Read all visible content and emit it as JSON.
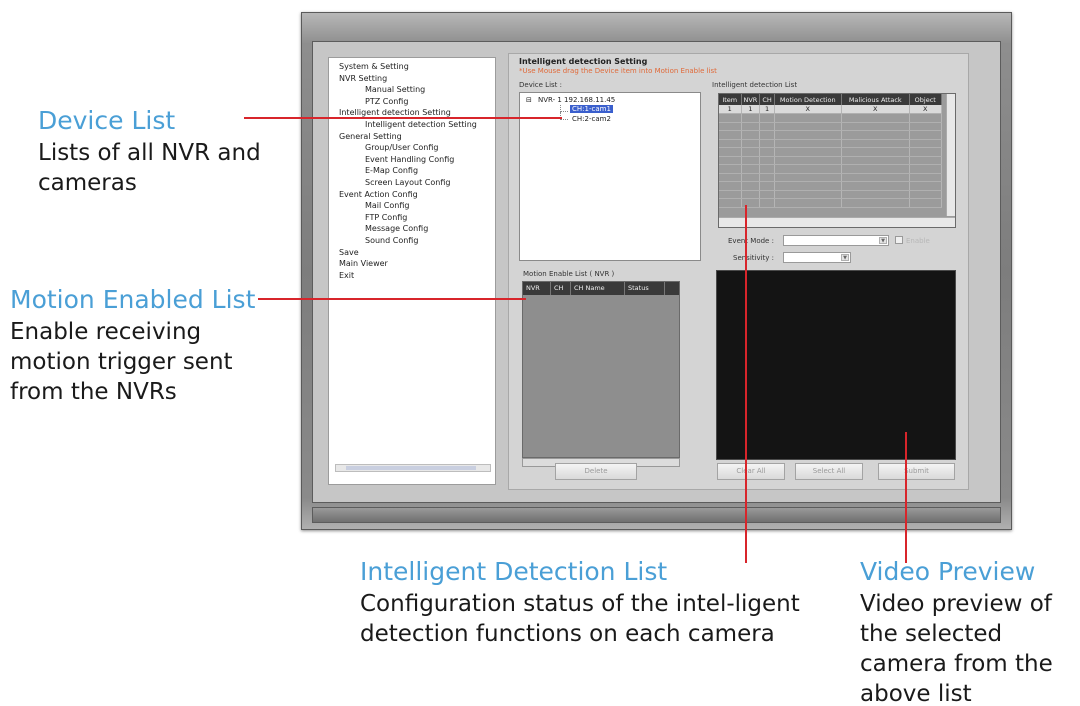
{
  "callouts": {
    "device_list": {
      "title": "Device List",
      "desc": "Lists of all NVR and cameras"
    },
    "motion_enabled": {
      "title": "Motion Enabled List",
      "desc": "Enable receiving motion trigger sent from the NVRs"
    },
    "intelligent_detection": {
      "title": "Intelligent Detection List",
      "desc": "Configuration status of the intel-ligent detection functions on each camera"
    },
    "video_preview": {
      "title": "Video Preview",
      "desc": "Video preview of the selected camera from the above list"
    }
  },
  "sidebar": {
    "items": [
      {
        "label": "System & Setting",
        "level": 0
      },
      {
        "label": "NVR  Setting",
        "level": 0
      },
      {
        "label": "Manual Setting",
        "level": 2
      },
      {
        "label": "PTZ Config",
        "level": 2
      },
      {
        "label": "Intelligent detection Setting",
        "level": 0
      },
      {
        "label": "Intelligent detection Setting",
        "level": 2
      },
      {
        "label": "General Setting",
        "level": 0
      },
      {
        "label": "Group/User Config",
        "level": 2
      },
      {
        "label": "Event Handling Config",
        "level": 2
      },
      {
        "label": "E-Map Config",
        "level": 2
      },
      {
        "label": "Screen Layout Config",
        "level": 2
      },
      {
        "label": "Event Action Config",
        "level": 0
      },
      {
        "label": "Mail Config",
        "level": 2
      },
      {
        "label": "FTP Config",
        "level": 2
      },
      {
        "label": "Message Config",
        "level": 2
      },
      {
        "label": "Sound Config",
        "level": 2
      },
      {
        "label": "Save",
        "level": 0
      },
      {
        "label": "Main Viewer",
        "level": 0
      },
      {
        "label": "Exit",
        "level": 0
      }
    ]
  },
  "panel": {
    "title": "Intelligent detection Setting",
    "hint": "*Use Mouse drag the Device item into Motion Enable list",
    "device_list_label": "Device List :",
    "detection_list_label": "Intelligent detection List",
    "motion_enable_label": "Motion Enable List  ( NVR )"
  },
  "device_tree": {
    "root": "NVR- 1 192.168.11.45",
    "children": [
      "CH:1-cam1",
      "CH:2-cam2"
    ],
    "selected_index": 0
  },
  "motion_table": {
    "columns": [
      "NVR",
      "CH",
      "CH Name",
      "Status"
    ]
  },
  "detection_table": {
    "columns": [
      "Item",
      "NVR",
      "CH",
      "Motion Detection",
      "Malicious Attack",
      "Object"
    ],
    "rows": [
      [
        "1",
        "1",
        "1",
        "X",
        "X",
        "X"
      ]
    ],
    "empty_rows": 11
  },
  "fields": {
    "event_mode_label": "Event Mode :",
    "sensitivity_label": "Sensitivity :",
    "checkbox_label": "Enable"
  },
  "buttons": {
    "delete": "Delete",
    "clear_all": "Clear All",
    "select_all": "Select All",
    "submit": "Submit"
  }
}
